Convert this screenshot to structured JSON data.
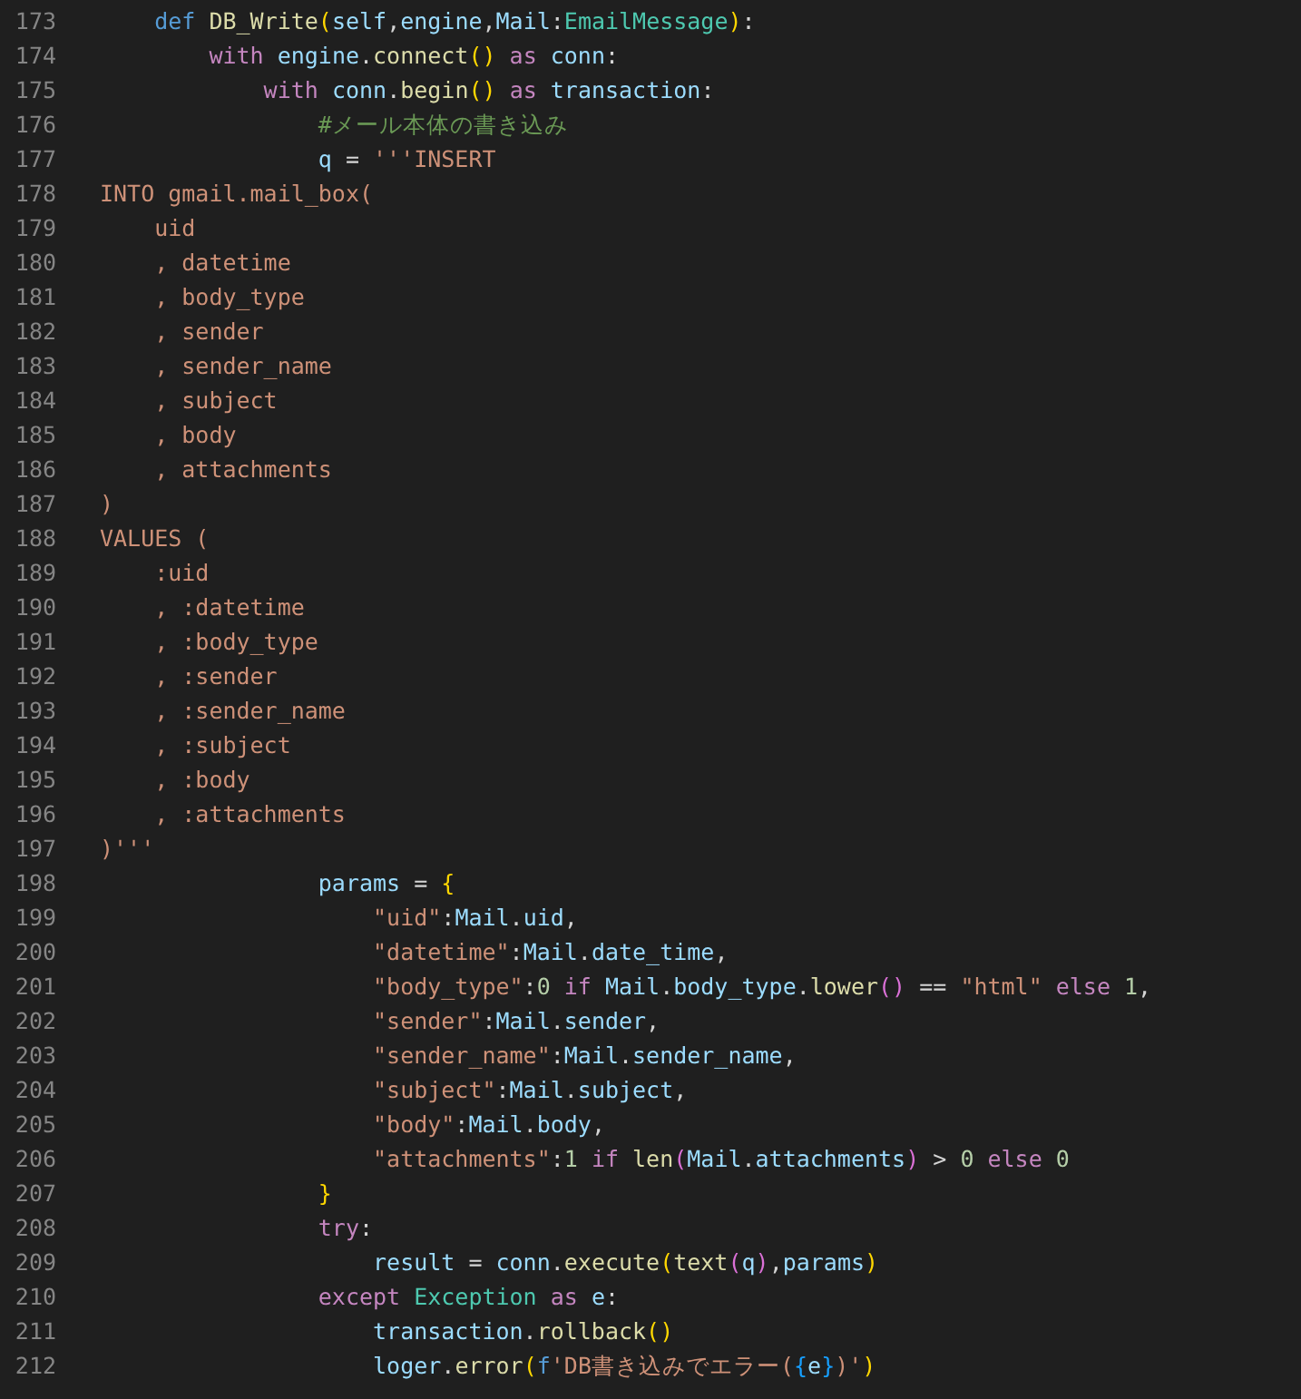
{
  "editor": {
    "lines": [
      {
        "number": "173",
        "tokens": [
          {
            "text": "    def",
            "kind": "keyword"
          },
          {
            "text": " DB_Write",
            "kind": "function"
          },
          {
            "text": "(",
            "kind": "bracket1"
          },
          {
            "text": "self",
            "kind": "variable"
          },
          {
            "text": ",",
            "kind": "plain"
          },
          {
            "text": "engine",
            "kind": "variable"
          },
          {
            "text": ",",
            "kind": "plain"
          },
          {
            "text": "Mail",
            "kind": "variable"
          },
          {
            "text": ":",
            "kind": "plain"
          },
          {
            "text": "EmailMessage",
            "kind": "class"
          },
          {
            "text": ")",
            "kind": "bracket1"
          },
          {
            "text": ":",
            "kind": "plain"
          }
        ]
      },
      {
        "number": "174",
        "tokens": [
          {
            "text": "        with",
            "kind": "control"
          },
          {
            "text": " engine",
            "kind": "variable"
          },
          {
            "text": ".",
            "kind": "plain"
          },
          {
            "text": "connect",
            "kind": "function"
          },
          {
            "text": "()",
            "kind": "bracket1"
          },
          {
            "text": " as",
            "kind": "control"
          },
          {
            "text": " conn",
            "kind": "variable"
          },
          {
            "text": ":",
            "kind": "plain"
          }
        ]
      },
      {
        "number": "175",
        "tokens": [
          {
            "text": "            with",
            "kind": "control"
          },
          {
            "text": " conn",
            "kind": "variable"
          },
          {
            "text": ".",
            "kind": "plain"
          },
          {
            "text": "begin",
            "kind": "function"
          },
          {
            "text": "()",
            "kind": "bracket1"
          },
          {
            "text": " as",
            "kind": "control"
          },
          {
            "text": " transaction",
            "kind": "variable"
          },
          {
            "text": ":",
            "kind": "plain"
          }
        ]
      },
      {
        "number": "176",
        "tokens": [
          {
            "text": "                #メール本体の書き込み",
            "kind": "comment"
          }
        ]
      },
      {
        "number": "177",
        "tokens": [
          {
            "text": "                q",
            "kind": "variable"
          },
          {
            "text": " = ",
            "kind": "plain"
          },
          {
            "text": "'''INSERT",
            "kind": "string"
          }
        ]
      },
      {
        "number": "178",
        "tokens": [
          {
            "text": "INTO gmail.mail_box(",
            "kind": "string"
          }
        ]
      },
      {
        "number": "179",
        "tokens": [
          {
            "text": "    uid",
            "kind": "string"
          }
        ]
      },
      {
        "number": "180",
        "tokens": [
          {
            "text": "    , datetime",
            "kind": "string"
          }
        ]
      },
      {
        "number": "181",
        "tokens": [
          {
            "text": "    , body_type",
            "kind": "string"
          }
        ]
      },
      {
        "number": "182",
        "tokens": [
          {
            "text": "    , sender",
            "kind": "string"
          }
        ]
      },
      {
        "number": "183",
        "tokens": [
          {
            "text": "    , sender_name",
            "kind": "string"
          }
        ]
      },
      {
        "number": "184",
        "tokens": [
          {
            "text": "    , subject",
            "kind": "string"
          }
        ]
      },
      {
        "number": "185",
        "tokens": [
          {
            "text": "    , body",
            "kind": "string"
          }
        ]
      },
      {
        "number": "186",
        "tokens": [
          {
            "text": "    , attachments",
            "kind": "string"
          }
        ]
      },
      {
        "number": "187",
        "tokens": [
          {
            "text": ")",
            "kind": "string"
          }
        ]
      },
      {
        "number": "188",
        "tokens": [
          {
            "text": "VALUES (",
            "kind": "string"
          }
        ]
      },
      {
        "number": "189",
        "tokens": [
          {
            "text": "    :uid",
            "kind": "string"
          }
        ]
      },
      {
        "number": "190",
        "tokens": [
          {
            "text": "    , :datetime",
            "kind": "string"
          }
        ]
      },
      {
        "number": "191",
        "tokens": [
          {
            "text": "    , :body_type",
            "kind": "string"
          }
        ]
      },
      {
        "number": "192",
        "tokens": [
          {
            "text": "    , :sender",
            "kind": "string"
          }
        ]
      },
      {
        "number": "193",
        "tokens": [
          {
            "text": "    , :sender_name",
            "kind": "string"
          }
        ]
      },
      {
        "number": "194",
        "tokens": [
          {
            "text": "    , :subject",
            "kind": "string"
          }
        ]
      },
      {
        "number": "195",
        "tokens": [
          {
            "text": "    , :body",
            "kind": "string"
          }
        ]
      },
      {
        "number": "196",
        "tokens": [
          {
            "text": "    , :attachments",
            "kind": "string"
          }
        ]
      },
      {
        "number": "197",
        "tokens": [
          {
            "text": ")'''",
            "kind": "string"
          }
        ]
      },
      {
        "number": "198",
        "tokens": [
          {
            "text": "                params",
            "kind": "variable"
          },
          {
            "text": " = ",
            "kind": "plain"
          },
          {
            "text": "{",
            "kind": "bracket1"
          }
        ]
      },
      {
        "number": "199",
        "tokens": [
          {
            "text": "                    \"uid\"",
            "kind": "string"
          },
          {
            "text": ":",
            "kind": "plain"
          },
          {
            "text": "Mail",
            "kind": "variable"
          },
          {
            "text": ".",
            "kind": "plain"
          },
          {
            "text": "uid",
            "kind": "variable"
          },
          {
            "text": ",",
            "kind": "plain"
          }
        ]
      },
      {
        "number": "200",
        "tokens": [
          {
            "text": "                    \"datetime\"",
            "kind": "string"
          },
          {
            "text": ":",
            "kind": "plain"
          },
          {
            "text": "Mail",
            "kind": "variable"
          },
          {
            "text": ".",
            "kind": "plain"
          },
          {
            "text": "date_time",
            "kind": "variable"
          },
          {
            "text": ",",
            "kind": "plain"
          }
        ]
      },
      {
        "number": "201",
        "tokens": [
          {
            "text": "                    \"body_type\"",
            "kind": "string"
          },
          {
            "text": ":",
            "kind": "plain"
          },
          {
            "text": "0",
            "kind": "number"
          },
          {
            "text": " if",
            "kind": "control"
          },
          {
            "text": " Mail",
            "kind": "variable"
          },
          {
            "text": ".",
            "kind": "plain"
          },
          {
            "text": "body_type",
            "kind": "variable"
          },
          {
            "text": ".",
            "kind": "plain"
          },
          {
            "text": "lower",
            "kind": "function"
          },
          {
            "text": "()",
            "kind": "bracket2"
          },
          {
            "text": " == ",
            "kind": "plain"
          },
          {
            "text": "\"html\"",
            "kind": "string"
          },
          {
            "text": " else",
            "kind": "control"
          },
          {
            "text": " 1",
            "kind": "number"
          },
          {
            "text": ",",
            "kind": "plain"
          }
        ]
      },
      {
        "number": "202",
        "tokens": [
          {
            "text": "                    \"sender\"",
            "kind": "string"
          },
          {
            "text": ":",
            "kind": "plain"
          },
          {
            "text": "Mail",
            "kind": "variable"
          },
          {
            "text": ".",
            "kind": "plain"
          },
          {
            "text": "sender",
            "kind": "variable"
          },
          {
            "text": ",",
            "kind": "plain"
          }
        ]
      },
      {
        "number": "203",
        "tokens": [
          {
            "text": "                    \"sender_name\"",
            "kind": "string"
          },
          {
            "text": ":",
            "kind": "plain"
          },
          {
            "text": "Mail",
            "kind": "variable"
          },
          {
            "text": ".",
            "kind": "plain"
          },
          {
            "text": "sender_name",
            "kind": "variable"
          },
          {
            "text": ",",
            "kind": "plain"
          }
        ]
      },
      {
        "number": "204",
        "tokens": [
          {
            "text": "                    \"subject\"",
            "kind": "string"
          },
          {
            "text": ":",
            "kind": "plain"
          },
          {
            "text": "Mail",
            "kind": "variable"
          },
          {
            "text": ".",
            "kind": "plain"
          },
          {
            "text": "subject",
            "kind": "variable"
          },
          {
            "text": ",",
            "kind": "plain"
          }
        ]
      },
      {
        "number": "205",
        "tokens": [
          {
            "text": "                    \"body\"",
            "kind": "string"
          },
          {
            "text": ":",
            "kind": "plain"
          },
          {
            "text": "Mail",
            "kind": "variable"
          },
          {
            "text": ".",
            "kind": "plain"
          },
          {
            "text": "body",
            "kind": "variable"
          },
          {
            "text": ",",
            "kind": "plain"
          }
        ]
      },
      {
        "number": "206",
        "tokens": [
          {
            "text": "                    \"attachments\"",
            "kind": "string"
          },
          {
            "text": ":",
            "kind": "plain"
          },
          {
            "text": "1",
            "kind": "number"
          },
          {
            "text": " if",
            "kind": "control"
          },
          {
            "text": " len",
            "kind": "function"
          },
          {
            "text": "(",
            "kind": "bracket2"
          },
          {
            "text": "Mail",
            "kind": "variable"
          },
          {
            "text": ".",
            "kind": "plain"
          },
          {
            "text": "attachments",
            "kind": "variable"
          },
          {
            "text": ")",
            "kind": "bracket2"
          },
          {
            "text": " > ",
            "kind": "plain"
          },
          {
            "text": "0",
            "kind": "number"
          },
          {
            "text": " else",
            "kind": "control"
          },
          {
            "text": " 0",
            "kind": "number"
          }
        ]
      },
      {
        "number": "207",
        "tokens": [
          {
            "text": "                }",
            "kind": "bracket1"
          }
        ]
      },
      {
        "number": "208",
        "tokens": [
          {
            "text": "                try",
            "kind": "control"
          },
          {
            "text": ":",
            "kind": "plain"
          }
        ]
      },
      {
        "number": "209",
        "tokens": [
          {
            "text": "                    result",
            "kind": "variable"
          },
          {
            "text": " = ",
            "kind": "plain"
          },
          {
            "text": "conn",
            "kind": "variable"
          },
          {
            "text": ".",
            "kind": "plain"
          },
          {
            "text": "execute",
            "kind": "function"
          },
          {
            "text": "(",
            "kind": "bracket1"
          },
          {
            "text": "text",
            "kind": "function"
          },
          {
            "text": "(",
            "kind": "bracket2"
          },
          {
            "text": "q",
            "kind": "variable"
          },
          {
            "text": ")",
            "kind": "bracket2"
          },
          {
            "text": ",",
            "kind": "plain"
          },
          {
            "text": "params",
            "kind": "variable"
          },
          {
            "text": ")",
            "kind": "bracket1"
          }
        ]
      },
      {
        "number": "210",
        "tokens": [
          {
            "text": "                except",
            "kind": "control"
          },
          {
            "text": " Exception",
            "kind": "class"
          },
          {
            "text": " as",
            "kind": "control"
          },
          {
            "text": " e",
            "kind": "variable"
          },
          {
            "text": ":",
            "kind": "plain"
          }
        ]
      },
      {
        "number": "211",
        "tokens": [
          {
            "text": "                    transaction",
            "kind": "variable"
          },
          {
            "text": ".",
            "kind": "plain"
          },
          {
            "text": "rollback",
            "kind": "function"
          },
          {
            "text": "()",
            "kind": "bracket1"
          }
        ]
      },
      {
        "number": "212",
        "tokens": [
          {
            "text": "                    loger",
            "kind": "variable"
          },
          {
            "text": ".",
            "kind": "plain"
          },
          {
            "text": "error",
            "kind": "function"
          },
          {
            "text": "(",
            "kind": "bracket1"
          },
          {
            "text": "f",
            "kind": "keyword"
          },
          {
            "text": "'DB書き込みでエラー(",
            "kind": "string"
          },
          {
            "text": "{",
            "kind": "bracket3"
          },
          {
            "text": "e",
            "kind": "variable"
          },
          {
            "text": "}",
            "kind": "bracket3"
          },
          {
            "text": ")'",
            "kind": "string"
          },
          {
            "text": ")",
            "kind": "bracket1"
          }
        ]
      }
    ]
  }
}
